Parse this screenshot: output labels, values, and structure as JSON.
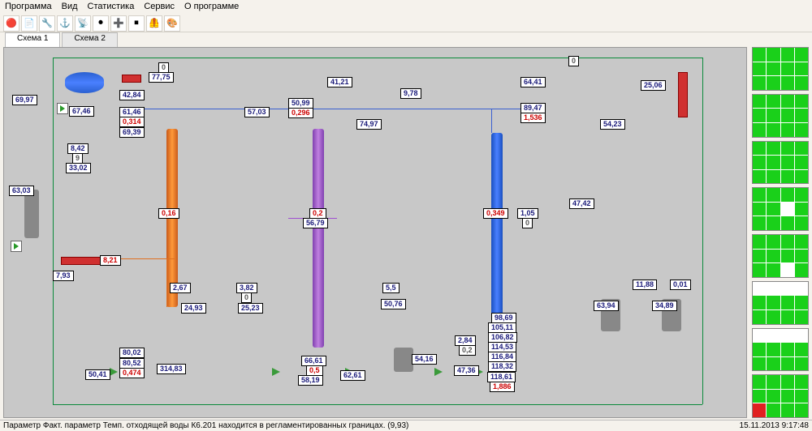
{
  "menu": {
    "items": [
      "Программа",
      "Вид",
      "Статистика",
      "Сервис",
      "О программе"
    ]
  },
  "toolbar_icons": [
    "🔴",
    "📄",
    "🔧",
    "⚓",
    "📡",
    "⏺",
    "➕",
    "⏹",
    "🦺",
    "🎨"
  ],
  "tabs": [
    {
      "label": "Схема 1",
      "active": true
    },
    {
      "label": "Схема 2",
      "active": false
    }
  ],
  "values": {
    "v69_97": "69,97",
    "v67_46": "67,46",
    "v8_42": "8,42",
    "v9": "9",
    "v33_02": "33,02",
    "v63_03": "63,03",
    "v7_93": "7,93",
    "v80_02": "80,02",
    "v80_52": "80,52",
    "v0_474": "0,474",
    "v314_83": "314,83",
    "v50_41": "50,41",
    "v0_top1": "0",
    "v77_75": "77,75",
    "v42_84": "42,84",
    "v61_46": "61,46",
    "v0_314": "0,314",
    "v69_39": "69,39",
    "v0_16": "0,16",
    "v8_21": "8,21",
    "v2_67": "2,67",
    "v24_93": "24,93",
    "v3_82": "3,82",
    "v0_mid": "0",
    "v41_21": "41,21",
    "v50_99": "50,99",
    "v0_296": "0,296",
    "v57_03": "57,03",
    "v74_97": "74,97",
    "v9_78": "9,78",
    "v0_2": "0,2",
    "v56_79": "56,79",
    "v25_23": "25,23",
    "v66_61": "66,61",
    "v0_5": "0,5",
    "v58_19": "58,19",
    "v62_61": "62,61",
    "v5_5": "5,5",
    "v50_76": "50,76",
    "v54_16": "54,16",
    "v2_84": "2,84",
    "v0_2b": "0,2",
    "v47_36": "47,36",
    "v118_61": "118,61",
    "v1_886": "1,886",
    "v0_right1": "0",
    "v64_41": "64,41",
    "v89_47": "89,47",
    "v1_536": "1,536",
    "v0_349": "0,349",
    "v1_05": "1,05",
    "v0_c": "0",
    "v54_23": "54,23",
    "v25_06": "25,06",
    "v47_42": "47,42",
    "v98_69": "98,69",
    "v105_11": "105,11",
    "v106_82": "106,82",
    "v114_53": "114,53",
    "v116_84": "116,84",
    "v118_32": "118,32",
    "v63_94": "63,94",
    "v34_89": "34,89",
    "v11_88": "11,88",
    "v0_01": "0,01"
  },
  "sidegrid": [
    [
      1,
      1,
      1,
      1,
      1,
      1,
      1,
      1,
      1,
      1,
      1,
      1
    ],
    [
      1,
      1,
      1,
      1,
      1,
      1,
      1,
      1,
      1,
      1,
      1,
      1
    ],
    [
      1,
      1,
      1,
      1,
      1,
      1,
      1,
      1,
      1,
      1,
      1,
      1
    ],
    [
      1,
      1,
      1,
      1,
      1,
      1,
      0,
      1,
      1,
      1,
      1,
      1
    ],
    [
      1,
      1,
      1,
      1,
      1,
      1,
      1,
      1,
      1,
      1,
      0,
      1
    ],
    [
      0,
      0,
      0,
      0,
      1,
      1,
      1,
      1,
      1,
      1,
      1,
      1
    ],
    [
      0,
      0,
      0,
      0,
      1,
      1,
      1,
      1,
      1,
      1,
      1,
      1
    ],
    [
      1,
      1,
      1,
      1,
      1,
      1,
      1,
      1,
      2,
      1,
      1,
      1
    ]
  ],
  "status": {
    "message": "Параметр Факт. параметр Темп. отходящей воды К6.201 находится в регламентированных границах. (9,93)",
    "time": "15.11.2013 9:17:48"
  }
}
